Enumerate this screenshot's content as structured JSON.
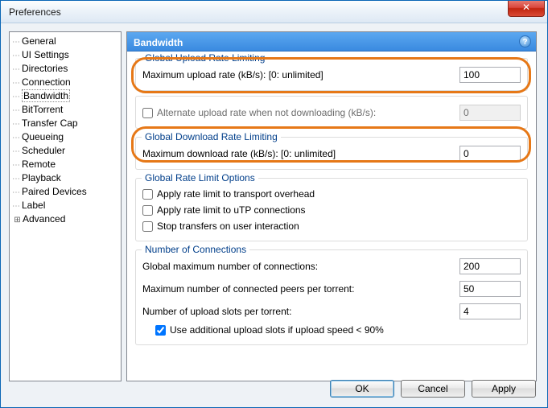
{
  "window": {
    "title": "Preferences"
  },
  "sidebar": {
    "items": [
      {
        "label": "General"
      },
      {
        "label": "UI Settings"
      },
      {
        "label": "Directories"
      },
      {
        "label": "Connection"
      },
      {
        "label": "Bandwidth",
        "selected": true
      },
      {
        "label": "BitTorrent"
      },
      {
        "label": "Transfer Cap"
      },
      {
        "label": "Queueing"
      },
      {
        "label": "Scheduler"
      },
      {
        "label": "Remote"
      },
      {
        "label": "Playback"
      },
      {
        "label": "Paired Devices"
      },
      {
        "label": "Label"
      },
      {
        "label": "Advanced",
        "expandable": true
      }
    ]
  },
  "panel": {
    "title": "Bandwidth",
    "help_tooltip": "?",
    "groups": {
      "upload": {
        "legend": "Global Upload Rate Limiting",
        "max_upload_label": "Maximum upload rate (kB/s): [0: unlimited]",
        "max_upload_value": "100",
        "alt_upload_label": "Alternate upload rate when not downloading (kB/s):",
        "alt_upload_checked": false,
        "alt_upload_value": "0"
      },
      "download": {
        "legend": "Global Download Rate Limiting",
        "max_download_label": "Maximum download rate (kB/s): [0: unlimited]",
        "max_download_value": "0"
      },
      "options": {
        "legend": "Global Rate Limit Options",
        "transport_label": "Apply rate limit to transport overhead",
        "transport_checked": false,
        "utp_label": "Apply rate limit to uTP connections",
        "utp_checked": false,
        "stop_label": "Stop transfers on user interaction",
        "stop_checked": false
      },
      "connections": {
        "legend": "Number of Connections",
        "global_max_label": "Global maximum number of connections:",
        "global_max_value": "200",
        "peers_label": "Maximum number of connected peers per torrent:",
        "peers_value": "50",
        "slots_label": "Number of upload slots per torrent:",
        "slots_value": "4",
        "additional_slots_label": "Use additional upload slots if upload speed < 90%",
        "additional_slots_checked": true
      }
    }
  },
  "buttons": {
    "ok": "OK",
    "cancel": "Cancel",
    "apply": "Apply"
  }
}
